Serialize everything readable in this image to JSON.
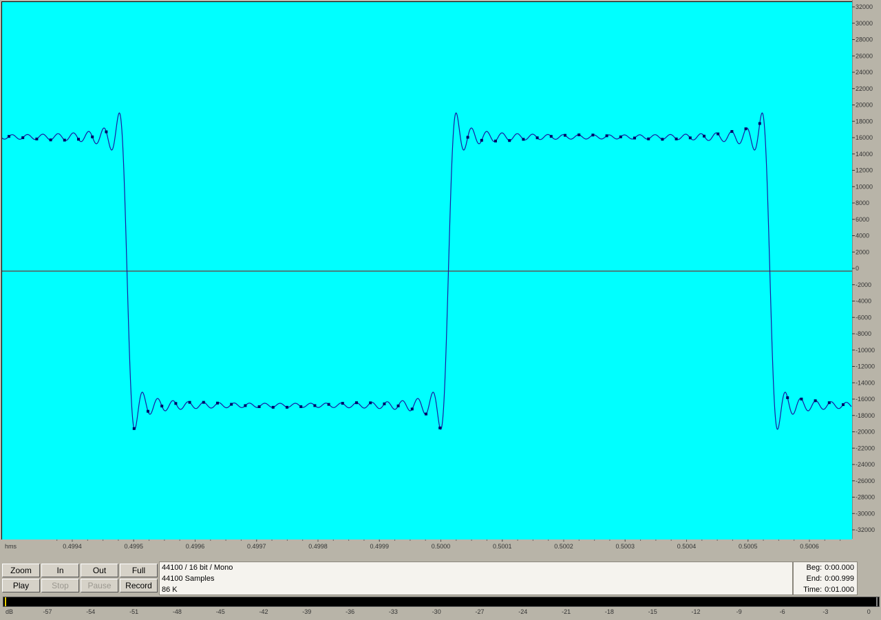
{
  "colors": {
    "wave_background": "#00ffff",
    "waveform": "#1a1aa0",
    "sample_markers": "#000066",
    "zero_line": "#8b0000",
    "panel": "#b8b4a8"
  },
  "y_axis": {
    "ticks": [
      "32000",
      "30000",
      "28000",
      "26000",
      "24000",
      "22000",
      "20000",
      "18000",
      "16000",
      "14000",
      "12000",
      "10000",
      "8000",
      "6000",
      "4000",
      "2000",
      "0",
      "-2000",
      "-4000",
      "-6000",
      "-8000",
      "-10000",
      "-12000",
      "-14000",
      "-16000",
      "-18000",
      "-20000",
      "-22000",
      "-24000",
      "-26000",
      "-28000",
      "-30000",
      "-32000"
    ]
  },
  "x_axis": {
    "unit_label": "hms",
    "ticks": [
      "0.4994",
      "0.4995",
      "0.4996",
      "0.4997",
      "0.4998",
      "0.4999",
      "0.5000",
      "0.5001",
      "0.5002",
      "0.5003",
      "0.5004",
      "0.5005",
      "0.5006"
    ]
  },
  "waveform": {
    "description_values": {
      "high_level": 16400,
      "low_level": -16400,
      "overshoot_peak": 21000
    }
  },
  "buttons": {
    "zoom": "Zoom",
    "in": "In",
    "out": "Out",
    "full": "Full",
    "play": "Play",
    "stop": "Stop",
    "pause": "Pause",
    "record": "Record"
  },
  "info": {
    "format": "44100 / 16 bit / Mono",
    "samples": "44100 Samples",
    "size": "86 K"
  },
  "time": {
    "beg_label": "Beg:",
    "beg_value": "0:00.000",
    "end_label": "End:",
    "end_value": "0:00.999",
    "time_label": "Time:",
    "time_value": "0:01.000"
  },
  "meter": {
    "unit_label": "dB",
    "ticks": [
      "-57",
      "-54",
      "-51",
      "-48",
      "-45",
      "-42",
      "-39",
      "-36",
      "-33",
      "-30",
      "-27",
      "-24",
      "-21",
      "-18",
      "-15",
      "-12",
      "-9",
      "-6",
      "-3",
      "0"
    ]
  }
}
